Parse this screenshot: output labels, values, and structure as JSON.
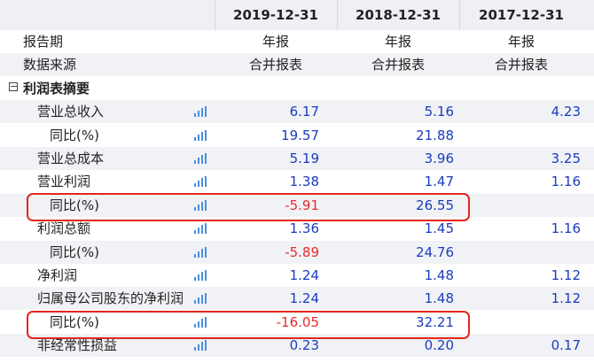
{
  "columns": [
    "2019-12-31",
    "2018-12-31",
    "2017-12-31"
  ],
  "rows": [
    {
      "label": "报告期",
      "values": [
        "年报",
        "年报",
        "年报"
      ],
      "type": "plain"
    },
    {
      "label": "数据来源",
      "values": [
        "合并报表",
        "合并报表",
        "合并报表"
      ],
      "type": "plain"
    },
    {
      "label": "利润表摘要",
      "values": [
        "",
        "",
        ""
      ],
      "type": "section"
    },
    {
      "label": "营业总收入",
      "values": [
        "6.17",
        "5.16",
        "4.23"
      ],
      "type": "data"
    },
    {
      "label": "同比(%)",
      "values": [
        "19.57",
        "21.88",
        ""
      ],
      "type": "data",
      "indent": true
    },
    {
      "label": "营业总成本",
      "values": [
        "5.19",
        "3.96",
        "3.25"
      ],
      "type": "data"
    },
    {
      "label": "营业利润",
      "values": [
        "1.38",
        "1.47",
        "1.16"
      ],
      "type": "data"
    },
    {
      "label": "同比(%)",
      "values": [
        "-5.91",
        "26.55",
        ""
      ],
      "type": "data",
      "indent": true
    },
    {
      "label": "利润总额",
      "values": [
        "1.36",
        "1.45",
        "1.16"
      ],
      "type": "data"
    },
    {
      "label": "同比(%)",
      "values": [
        "-5.89",
        "24.76",
        ""
      ],
      "type": "data",
      "indent": true
    },
    {
      "label": "净利润",
      "values": [
        "1.24",
        "1.48",
        "1.12"
      ],
      "type": "data"
    },
    {
      "label": "归属母公司股东的净利润",
      "values": [
        "1.24",
        "1.48",
        "1.12"
      ],
      "type": "data"
    },
    {
      "label": "同比(%)",
      "values": [
        "-16.05",
        "32.21",
        ""
      ],
      "type": "data",
      "indent": true
    },
    {
      "label": "非经常性损益",
      "values": [
        "0.23",
        "0.20",
        "0.17"
      ],
      "type": "data"
    }
  ],
  "icons": {
    "chart": "bar-chart-icon",
    "collapse": "collapse-minus-icon"
  },
  "colors": {
    "positive": "#1a3bbf",
    "negative": "#e82b2b",
    "highlight": "#e5261c",
    "stripe": "#f1f2f5"
  }
}
